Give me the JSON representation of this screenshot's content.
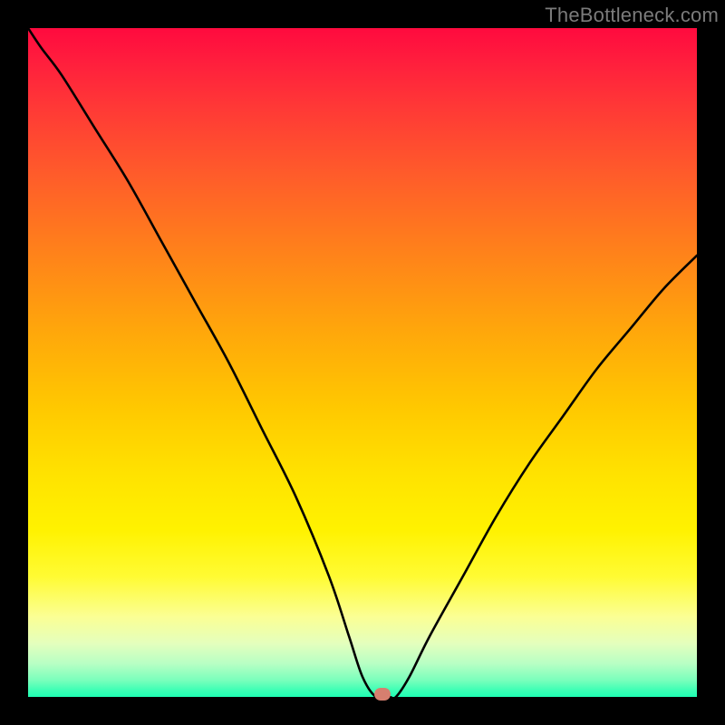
{
  "watermark": "TheBottleneck.com",
  "chart_data": {
    "type": "line",
    "title": "",
    "xlabel": "",
    "ylabel": "",
    "xlim": [
      0,
      100
    ],
    "ylim": [
      0,
      100
    ],
    "grid": false,
    "legend": "none",
    "series": [
      {
        "name": "curve",
        "x": [
          0,
          2,
          5,
          10,
          15,
          20,
          25,
          30,
          35,
          40,
          45,
          48,
          50,
          52,
          54,
          55,
          57,
          60,
          65,
          70,
          75,
          80,
          85,
          90,
          95,
          100
        ],
        "y": [
          100,
          97,
          93,
          85,
          77,
          68,
          59,
          50,
          40,
          30,
          18,
          9,
          3,
          0,
          0,
          0,
          3,
          9,
          18,
          27,
          35,
          42,
          49,
          55,
          61,
          66
        ]
      }
    ],
    "marker": {
      "x": 53,
      "y": 0
    },
    "background_gradient": {
      "direction": "vertical",
      "stops": [
        {
          "pos": 0.0,
          "color": "#ff0a3e"
        },
        {
          "pos": 0.5,
          "color": "#ffd000"
        },
        {
          "pos": 0.9,
          "color": "#fbff94"
        },
        {
          "pos": 1.0,
          "color": "#1fffb4"
        }
      ]
    }
  }
}
